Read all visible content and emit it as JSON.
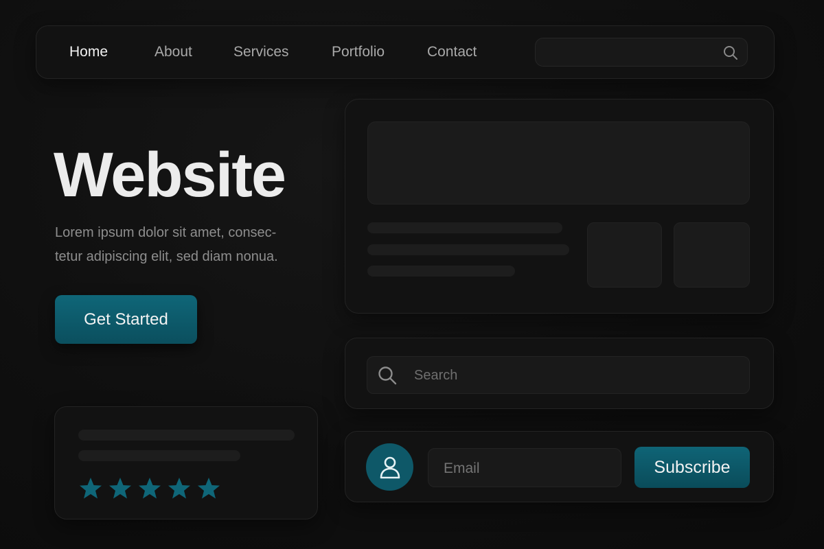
{
  "nav": {
    "items": [
      {
        "label": "Home",
        "active": true
      },
      {
        "label": "About",
        "active": false
      },
      {
        "label": "Services",
        "active": false
      },
      {
        "label": "Portfolio",
        "active": false
      },
      {
        "label": "Contact",
        "active": false
      }
    ],
    "search": {
      "value": "",
      "placeholder": "",
      "icon": "search-icon"
    }
  },
  "hero": {
    "title": "Website",
    "text_lines": [
      "Lorem ipsum dolor sit amet, consec-",
      "tetur adipiscing elit, sed diam nonua."
    ],
    "cta_label": "Get Started"
  },
  "search_card": {
    "placeholder": "Search",
    "icon": "search-icon"
  },
  "subscribe": {
    "avatar_icon": "user-icon",
    "email_placeholder": "Email",
    "button_label": "Subscribe"
  },
  "review": {
    "rating": 5,
    "max_rating": 5,
    "star_icon": "star-icon"
  },
  "colors": {
    "background": "#0f0f0f",
    "panel": "#121212",
    "accent": "#0f6678",
    "text_primary": "#ececec",
    "text_muted": "#8e8e8e"
  }
}
